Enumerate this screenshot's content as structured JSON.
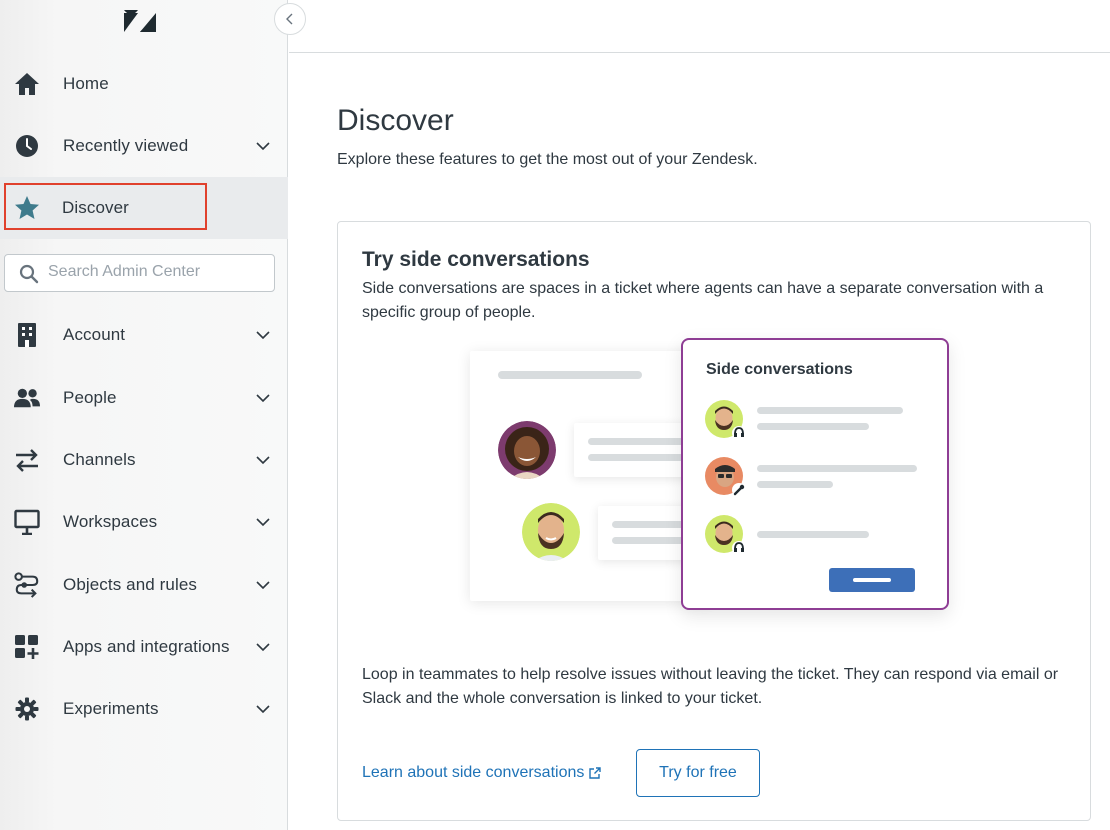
{
  "sidebar": {
    "collapse_icon": "chevron-left-icon",
    "items": [
      {
        "label": "Home",
        "icon": "home-icon"
      },
      {
        "label": "Recently viewed",
        "icon": "clock-icon"
      },
      {
        "label": "Discover",
        "icon": "star-icon",
        "active": true
      },
      {
        "label": "Account",
        "icon": "building-icon"
      },
      {
        "label": "People",
        "icon": "people-icon"
      },
      {
        "label": "Channels",
        "icon": "arrows-icon"
      },
      {
        "label": "Workspaces",
        "icon": "monitor-icon"
      },
      {
        "label": "Objects and rules",
        "icon": "objects-icon"
      },
      {
        "label": "Apps and integrations",
        "icon": "apps-icon"
      },
      {
        "label": "Experiments",
        "icon": "gear-icon"
      }
    ],
    "search": {
      "placeholder": "Search Admin Center"
    }
  },
  "main": {
    "title": "Discover",
    "subtitle": "Explore these features to get the most out of your Zendesk.",
    "card": {
      "title": "Try side conversations",
      "description": "Side conversations are spaces in a ticket where agents can have a separate conversation with a specific group of people.",
      "illustration": {
        "panel_title": "Side conversations"
      },
      "description2": "Loop in teammates to help resolve issues without leaving the ticket. They can respond via email or Slack and the whole conversation is linked to your ticket.",
      "learn_link": "Learn about side conversations",
      "try_button": "Try for free"
    }
  },
  "colors": {
    "accent": "#1f73b7",
    "highlight_outline": "#e0412d",
    "panel_border": "#8e3d94",
    "star": "#3f7b8c"
  }
}
